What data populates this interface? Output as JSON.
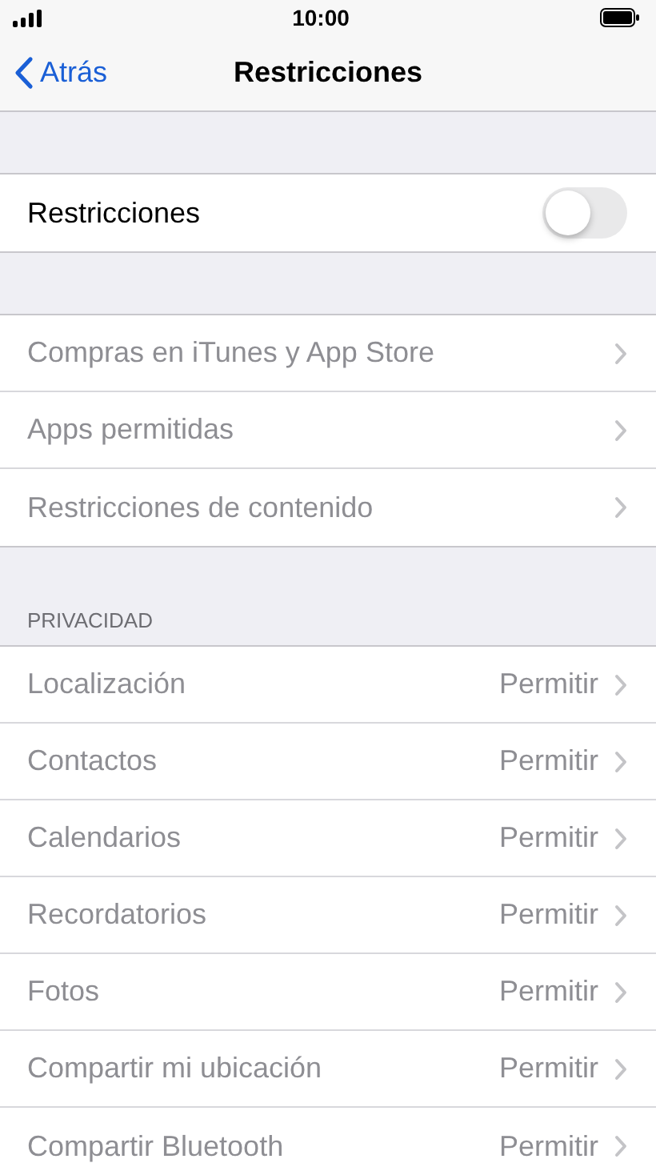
{
  "status_bar": {
    "time": "10:00"
  },
  "nav": {
    "back": "Atrás",
    "title": "Restricciones"
  },
  "master": {
    "label": "Restricciones",
    "on": false
  },
  "general": [
    {
      "label": "Compras en iTunes y App Store",
      "disabled": true
    },
    {
      "label": "Apps permitidas",
      "disabled": true
    },
    {
      "label": "Restricciones de contenido",
      "disabled": true
    }
  ],
  "privacy": {
    "header": "PRIVACIDAD",
    "items": [
      {
        "label": "Localización",
        "value": "Permitir",
        "disabled": true
      },
      {
        "label": "Contactos",
        "value": "Permitir",
        "disabled": true
      },
      {
        "label": "Calendarios",
        "value": "Permitir",
        "disabled": true
      },
      {
        "label": "Recordatorios",
        "value": "Permitir",
        "disabled": true
      },
      {
        "label": "Fotos",
        "value": "Permitir",
        "disabled": true
      },
      {
        "label": "Compartir mi ubicación",
        "value": "Permitir",
        "disabled": true
      },
      {
        "label": "Compartir Bluetooth",
        "value": "Permitir",
        "disabled": true
      }
    ]
  }
}
